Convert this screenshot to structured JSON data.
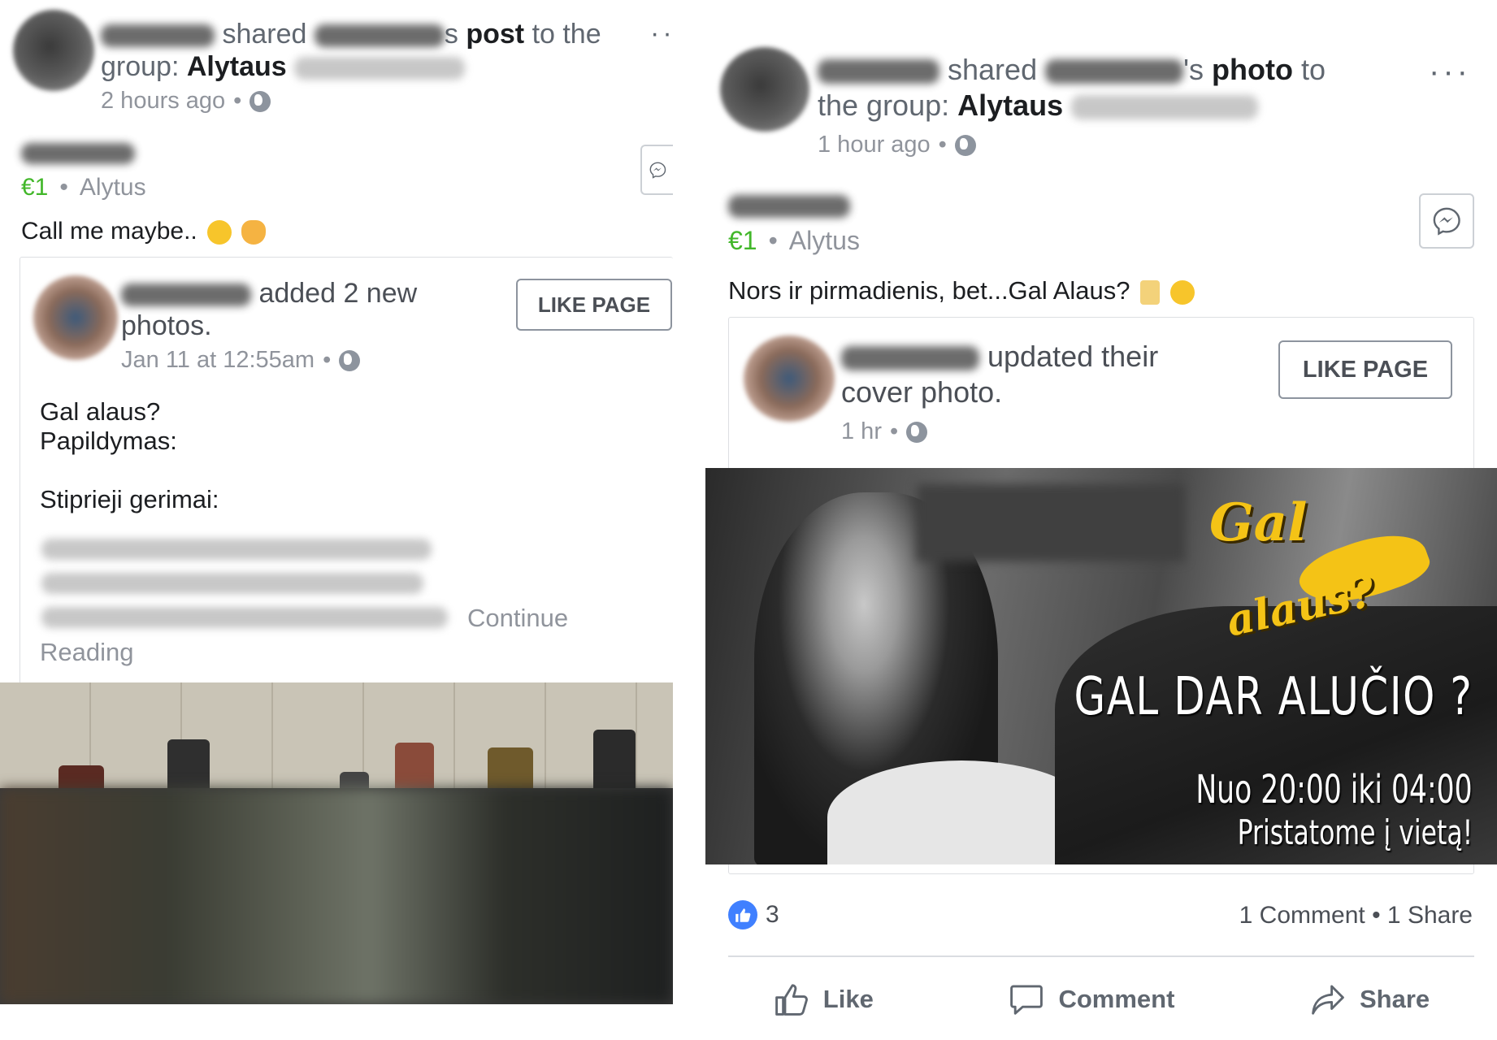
{
  "left_post": {
    "shared_word": "shared",
    "object_word": "post",
    "to_the": "to the",
    "group_prefix": "group:",
    "group_name": "Alytaus",
    "time": "2 hours ago",
    "separator": "•",
    "price": "€1",
    "location": "Alytus",
    "caption": "Call me maybe..",
    "inner": {
      "action": "added 2 new",
      "action_cont": "photos.",
      "time": "Jan 11 at 12:55am",
      "like_page": "LIKE PAGE",
      "body": "Gal alaus?\nPapildymas:\n\nStiprieji gerimai:",
      "continue": "Continue",
      "reading": "Reading"
    }
  },
  "right_post": {
    "shared_word": "shared",
    "object_word": "photo",
    "to_word": "to",
    "group_prefix": "the group:",
    "group_name": "Alytaus",
    "time": "1 hour ago",
    "separator": "•",
    "price": "€1",
    "location": "Alytus",
    "caption": "Nors ir pirmadienis, bet...Gal Alaus?",
    "inner": {
      "action": "updated their",
      "action_cont": "cover photo.",
      "time": "1 hr",
      "like_page": "LIKE PAGE"
    },
    "banner": {
      "logo_top": "Gal",
      "logo_bottom": "alaus?",
      "headline": "GAL DAR ALUČIO ?",
      "hours": "Nuo 20:00 iki 04:00",
      "delivery": "Pristatome į vietą!"
    },
    "likes_count": "3",
    "comments": "1 Comment",
    "shares": "1 Share",
    "actions": {
      "like": "Like",
      "comment": "Comment",
      "share": "Share"
    }
  },
  "colors": {
    "price_green": "#42b72a",
    "link_blue": "#4080ff",
    "meta_gray": "#90949c"
  },
  "icons": [
    "globe-icon",
    "messenger-icon",
    "more-options-icon",
    "like-icon",
    "comment-icon",
    "share-icon"
  ]
}
